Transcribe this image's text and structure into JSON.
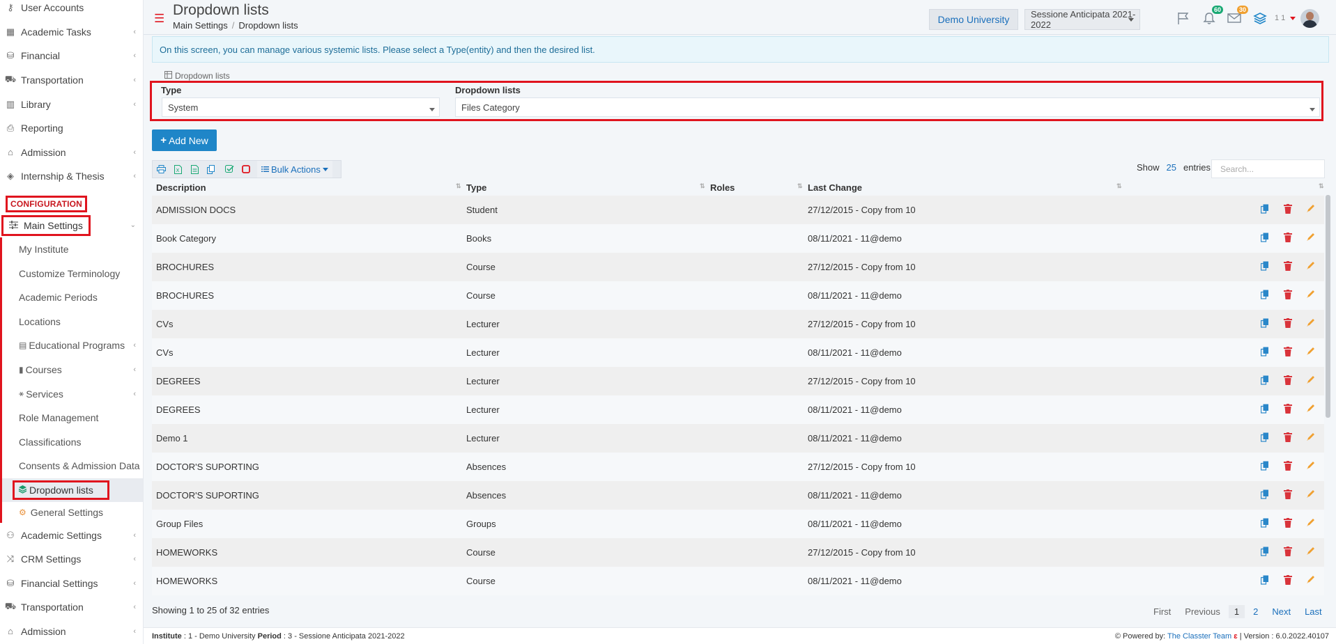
{
  "sidebar": {
    "items_top": [
      {
        "label": "User Accounts",
        "icon": "key-icon",
        "chevron": false
      },
      {
        "label": "Academic Tasks",
        "icon": "grid-icon",
        "chevron": true
      },
      {
        "label": "Financial",
        "icon": "coins-icon",
        "chevron": true
      },
      {
        "label": "Transportation",
        "icon": "bus-icon",
        "chevron": true
      },
      {
        "label": "Library",
        "icon": "books-icon",
        "chevron": true
      },
      {
        "label": "Reporting",
        "icon": "print-icon",
        "chevron": false
      },
      {
        "label": "Admission",
        "icon": "bank-icon",
        "chevron": true
      },
      {
        "label": "Internship & Thesis",
        "icon": "cube-icon",
        "chevron": true
      }
    ],
    "section_label": "CONFIGURATION",
    "main_settings": "Main Settings",
    "sub_items": [
      {
        "label": "My Institute",
        "icon": "",
        "chevron": false
      },
      {
        "label": "Customize Terminology",
        "icon": "",
        "chevron": false
      },
      {
        "label": "Academic Periods",
        "icon": "",
        "chevron": false
      },
      {
        "label": "Locations",
        "icon": "",
        "chevron": false
      },
      {
        "label": "Educational Programs",
        "icon": "programs-icon",
        "chevron": true
      },
      {
        "label": "Courses",
        "icon": "book-icon",
        "chevron": true
      },
      {
        "label": "Services",
        "icon": "services-icon",
        "chevron": true
      },
      {
        "label": "Role Management",
        "icon": "",
        "chevron": false
      },
      {
        "label": "Classifications",
        "icon": "",
        "chevron": false
      },
      {
        "label": "Consents & Admission Data",
        "icon": "",
        "chevron": false
      }
    ],
    "active_item": "Dropdown lists",
    "general_settings": "General Settings",
    "items_bottom": [
      {
        "label": "Academic Settings",
        "icon": "people-icon",
        "chevron": true
      },
      {
        "label": "CRM Settings",
        "icon": "crm-icon",
        "chevron": true
      },
      {
        "label": "Financial Settings",
        "icon": "coins-icon",
        "chevron": true
      },
      {
        "label": "Transportation",
        "icon": "bus-icon",
        "chevron": true
      },
      {
        "label": "Admission",
        "icon": "bank-icon",
        "chevron": true
      }
    ]
  },
  "header": {
    "title": "Dropdown lists",
    "breadcrumb": [
      "Main Settings",
      "Dropdown lists"
    ],
    "university_button": "Demo University",
    "session": "Sessione Anticipata 2021-2022",
    "notifications_count": "60",
    "messages_count": "30",
    "user_numbers": "1 1"
  },
  "info_text": "On this screen, you can manage various systemic lists. Please select a Type(entity) and then the desired list.",
  "caption": "Dropdown lists",
  "filter": {
    "type_label": "Type",
    "type_value": "System",
    "list_label": "Dropdown lists",
    "list_value": "Files Category"
  },
  "add_new": "Add New",
  "toolbar": {
    "bulk_actions": "Bulk Actions"
  },
  "show_entries": {
    "show": "Show",
    "count": "25",
    "entries": "entries"
  },
  "search_placeholder": "Search...",
  "table": {
    "columns": [
      "Description",
      "Type",
      "Roles",
      "Last Change"
    ],
    "rows": [
      [
        "ADMISSION DOCS",
        "Student",
        "",
        "27/12/2015 - Copy from 10"
      ],
      [
        "Book Category",
        "Books",
        "",
        "08/11/2021 - 11@demo"
      ],
      [
        "BROCHURES",
        "Course",
        "",
        "27/12/2015 - Copy from 10"
      ],
      [
        "BROCHURES",
        "Course",
        "",
        "08/11/2021 - 11@demo"
      ],
      [
        "CVs",
        "Lecturer",
        "",
        "27/12/2015 - Copy from 10"
      ],
      [
        "CVs",
        "Lecturer",
        "",
        "08/11/2021 - 11@demo"
      ],
      [
        "DEGREES",
        "Lecturer",
        "",
        "27/12/2015 - Copy from 10"
      ],
      [
        "DEGREES",
        "Lecturer",
        "",
        "08/11/2021 - 11@demo"
      ],
      [
        "Demo 1",
        "Lecturer",
        "",
        "08/11/2021 - 11@demo"
      ],
      [
        "DOCTOR'S SUPORTING",
        "Absences",
        "",
        "27/12/2015 - Copy from 10"
      ],
      [
        "DOCTOR'S SUPORTING",
        "Absences",
        "",
        "08/11/2021 - 11@demo"
      ],
      [
        "Group Files",
        "Groups",
        "",
        "08/11/2021 - 11@demo"
      ],
      [
        "HOMEWORKS",
        "Course",
        "",
        "27/12/2015 - Copy from 10"
      ],
      [
        "HOMEWORKS",
        "Course",
        "",
        "08/11/2021 - 11@demo"
      ]
    ]
  },
  "showing": "Showing 1 to 25 of 32 entries",
  "pager": [
    "First",
    "Previous",
    "1",
    "2",
    "Next",
    "Last"
  ],
  "footer": {
    "institute_label": "Institute",
    "institute_value": ": 1 - Demo University",
    "period_label": "Period",
    "period_value": ": 3 - Sessione Anticipata 2021-2022",
    "powered_by": "Powered by:",
    "powered_link": "The Classter Team",
    "version": "| Version : 6.0.2022.40107"
  },
  "colors": {
    "accent": "#1f86c8",
    "highlight": "#e0141e",
    "delete": "#d9343b",
    "edit": "#f0a030",
    "copy": "#2a87c9"
  }
}
